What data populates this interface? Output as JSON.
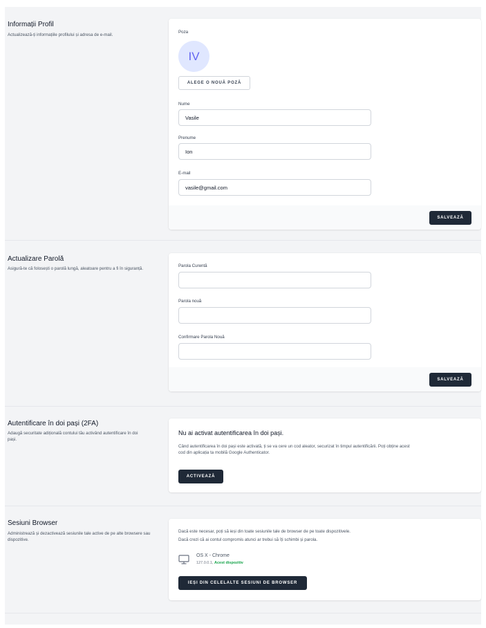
{
  "profile": {
    "title": "Informații Profil",
    "description": "Actualizează-ți informațiile profilului și adresa de e-mail.",
    "photo_label": "Poza",
    "avatar_initials": "IV",
    "new_photo_button": "ALEGE O NOUĂ POZĂ",
    "first_name_label": "Nume",
    "first_name_value": "Vasile",
    "last_name_label": "Prenume",
    "last_name_value": "Ion",
    "email_label": "E-mail",
    "email_value": "vasile@gmail.com",
    "save_button": "SALVEAZĂ"
  },
  "password": {
    "title": "Actualizare Parolă",
    "description": "Asigură-te că folosești o parolă lungă, aleatoare pentru a fi în siguranță.",
    "current_label": "Parola Curentă",
    "new_label": "Parola nouă",
    "confirm_label": "Confirmare Parola Nouă",
    "save_button": "SALVEAZĂ"
  },
  "twofa": {
    "title": "Autentificare în doi pași (2FA)",
    "description": "Adaugă securitate adițională contului tău activând autentificare în doi pași.",
    "heading": "Nu ai activat autentificarea în doi pași.",
    "body": "Când autentificarea în doi pași este activată, ți se va cere un cod aleator, securizat în timpul autentificării. Poți obține acest cod din aplicația ta mobilă Google Authenticator.",
    "activate_button": "ACTIVEAZĂ"
  },
  "sessions": {
    "title": "Sesiuni Browser",
    "description": "Administrează și dezactivează sesiunile tale active de pe alte browsere sau dispozitive.",
    "body_line1": "Dacă este necesar, poți să ieși din toate sesiunile tale de browser de pe toate dispozitivele.",
    "body_line2": "Dacă crezi că ai contul compromis atunci ar trebui să îți schimbi și parola.",
    "device_name": "OS X - Chrome",
    "device_ip": "127.0.0.1,",
    "device_current": "Acest dispozitiv",
    "logout_button": "IEȘI DIN CELELALTE SESIUNI DE BROWSER"
  },
  "colors": {
    "accent_dark": "#1f2937",
    "avatar_bg": "#e0e7ff",
    "avatar_fg": "#6366f1",
    "current_device": "#16a34a"
  }
}
